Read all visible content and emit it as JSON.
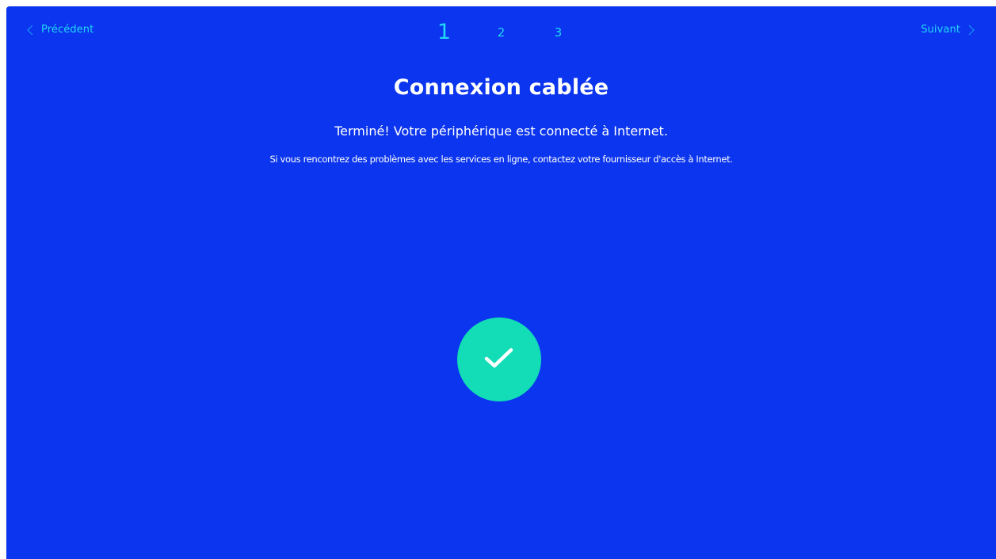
{
  "nav": {
    "prev_label": "Précédent",
    "next_label": "Suivant"
  },
  "steps": {
    "current": "1",
    "second": "2",
    "third": "3"
  },
  "content": {
    "title": "Connexion cablée",
    "status_message": "Terminé! Votre périphérique est connecté à Internet.",
    "help_message": "Si vous rencontrez des problèmes avec les services en ligne, contactez votre fournisseur d'accès à Internet."
  },
  "icons": {
    "success": "checkmark-icon",
    "prev": "chevron-left-icon",
    "next": "chevron-right-icon"
  },
  "colors": {
    "background": "#0b35ee",
    "accent": "#22d7f6",
    "success": "#12ddb6",
    "text": "#ffffff"
  }
}
